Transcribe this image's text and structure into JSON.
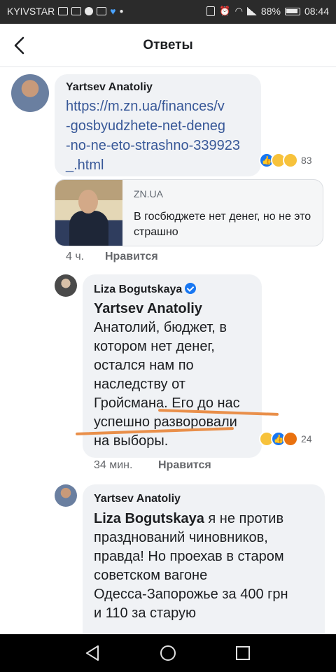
{
  "statusbar": {
    "carrier": "KYIVSTAR",
    "battery": "88%",
    "time": "08:44"
  },
  "header": {
    "title": "Ответы"
  },
  "comments": [
    {
      "author": "Yartsev Anatoliy",
      "link_lines": [
        "https://m.zn.ua/finances/v",
        "-gosbyudzhete-net-deneg",
        "-no-ne-eto-strashno-339923",
        "_.html"
      ],
      "reactions": [
        "like",
        "sad",
        "haha"
      ],
      "reaction_count": "83",
      "preview": {
        "source": "ZN.UA",
        "title": "В госбюджете нет денег, но не это страшно"
      },
      "time": "4 ч.",
      "like_label": "Нравится"
    },
    {
      "author": "Liza Bogutskaya",
      "verified": true,
      "mention": "Yartsev Anatoliy",
      "text_lines": [
        "Анатолий, бюджет, в",
        "котором нет денег,",
        "остался нам по",
        "наследству от",
        "Гройсмана. Его до нас",
        "успешно разворовали",
        "на выборы."
      ],
      "reactions": [
        "haha",
        "like",
        "angry"
      ],
      "reaction_count": "24",
      "time": "34 мин.",
      "like_label": "Нравится"
    },
    {
      "author": "Yartsev Anatoliy",
      "mention": "Liza Bogutskaya",
      "text_first": " я не против",
      "text_lines": [
        "празднований чиновников,",
        "правда! Но проехав в старом",
        "советском вагоне",
        "Одесса-Запорожье за 400 грн",
        "и 110 за старую"
      ]
    }
  ],
  "colors": {
    "link": "#385898",
    "bubble": "#f0f2f5",
    "highlight": "#e98f4a",
    "like": "#1877f2"
  }
}
